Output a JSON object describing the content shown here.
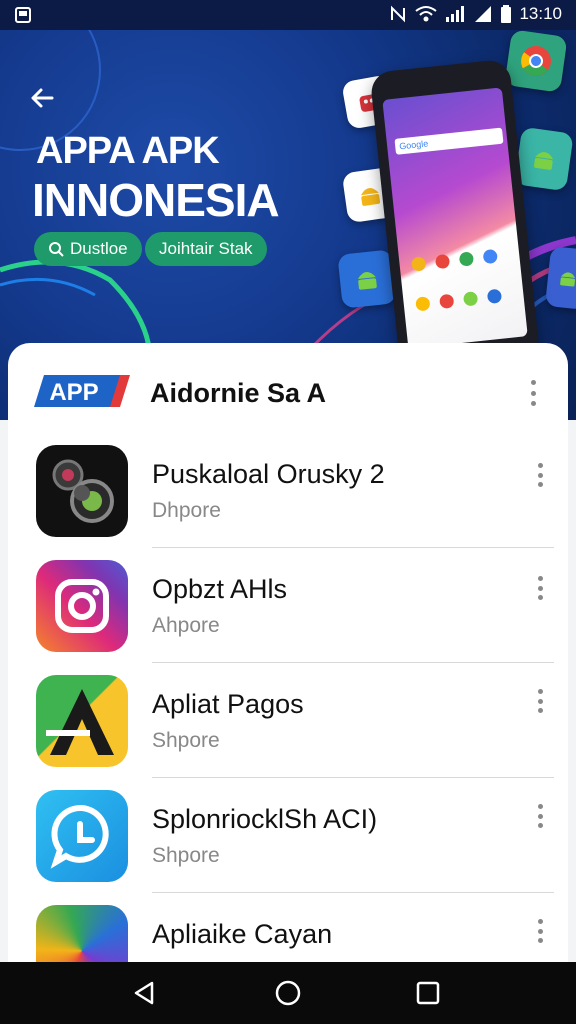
{
  "status_bar": {
    "time": "13:10"
  },
  "hero": {
    "title_line1": "APPA APK",
    "title_line2": "INNONESIA",
    "chip1_label": "Dustloe",
    "chip2_label": "Joihtair Stak",
    "phone_search_text": "Google"
  },
  "card": {
    "badge_text": "APP",
    "title": "Aidornie Sa A",
    "apps": [
      {
        "name": "Puskaloal Orusky 2",
        "sub": "Dhpore"
      },
      {
        "name": "Opbzt AHls",
        "sub": "Ahpore"
      },
      {
        "name": "Apliat Pagos",
        "sub": "Shpore"
      },
      {
        "name": "SplonriocklSh ACI)",
        "sub": "Shpore"
      },
      {
        "name": "Apliaike Cayan",
        "sub": ""
      }
    ]
  },
  "colors": {
    "hero_blue": "#143a8e",
    "chip_green": "#1f9a6a",
    "badge_blue": "#1e63c6",
    "badge_red": "#e23a3a"
  }
}
